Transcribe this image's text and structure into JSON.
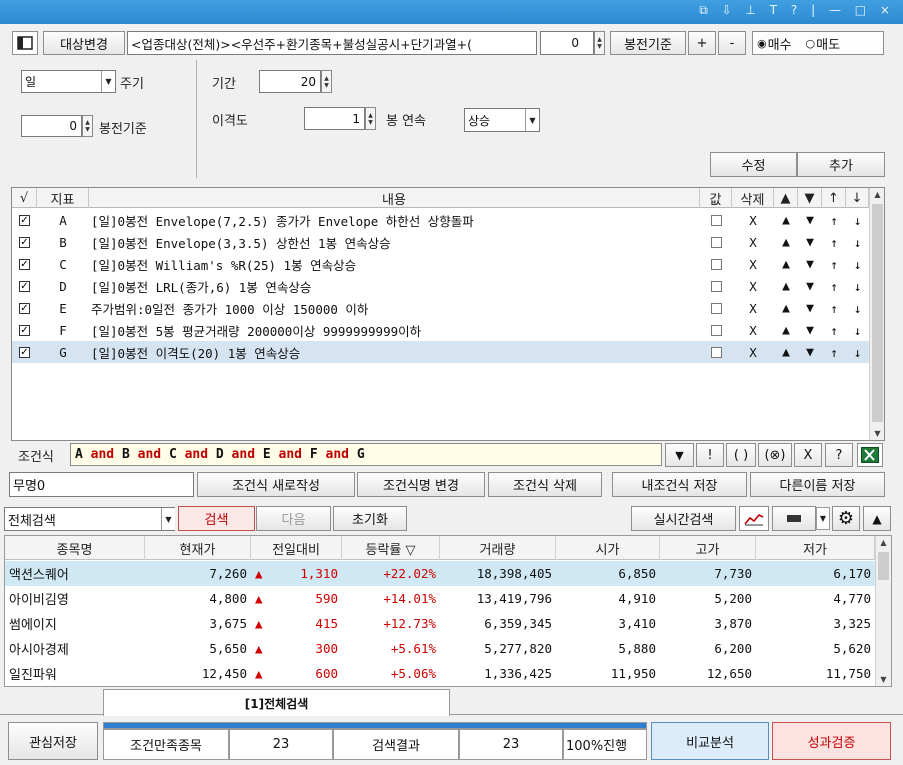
{
  "toolbar": {
    "target_change_label": "대상변경",
    "target_value": "<업종대상(전체)><우선주+환기종목+불성실공시+단기과열+(",
    "bong_value": "0",
    "bong_label": "봉전기준",
    "plus_label": "+",
    "minus_label": "-",
    "buy_label": "매수",
    "sell_label": "매도"
  },
  "params": {
    "period_type": "일",
    "cycle_label": "주기",
    "bong_value": "0",
    "bong_label": "봉전기준",
    "range_label": "기간",
    "range_value": "20",
    "disparity_label": "이격도",
    "consec_value": "1",
    "consec_label": "봉 연속",
    "direction": "상승",
    "edit_label": "수정",
    "add_label": "추가"
  },
  "conditions": {
    "headers": [
      "√",
      "지표",
      "내용",
      "값",
      "삭제",
      "▲",
      "▼",
      "↑",
      "↓"
    ],
    "rows": [
      {
        "id": "A",
        "content": "[일]0봉전 Envelope(7,2.5) 종가가 Envelope 하한선 상향돌파",
        "del": "X"
      },
      {
        "id": "B",
        "content": "[일]0봉전 Envelope(3,3.5) 상한선 1봉 연속상승",
        "del": "X"
      },
      {
        "id": "C",
        "content": "[일]0봉전 William's %R(25) 1봉 연속상승",
        "del": "X"
      },
      {
        "id": "D",
        "content": "[일]0봉전 LRL(종가,6) 1봉 연속상승",
        "del": "X"
      },
      {
        "id": "E",
        "content": "주가범위:0일전 종가가 1000 이상 150000 이하",
        "del": "X"
      },
      {
        "id": "F",
        "content": "[일]0봉전 5봉 평균거래량 200000이상 9999999999이하",
        "del": "X"
      },
      {
        "id": "G",
        "content": "[일]0봉전 이격도(20) 1봉 연속상승",
        "del": "X"
      }
    ]
  },
  "formula": {
    "label": "조건식",
    "tokens": [
      "A",
      " and ",
      "B",
      " and ",
      "C",
      " and ",
      "D",
      " and ",
      "E",
      " and ",
      "F",
      " and ",
      "G"
    ],
    "btn_down": "▼",
    "btn_not": "!",
    "btn_paren": "( )",
    "btn_xor": "(⊗)",
    "btn_x": "X",
    "btn_help": "?"
  },
  "actions": {
    "name_value": "무명0",
    "new_label": "조건식 새로작성",
    "rename_label": "조건식명 변경",
    "delete_label": "조건식 삭제",
    "save_label": "내조건식 저장",
    "save_as_label": "다른이름 저장"
  },
  "search": {
    "scope": "전체검색",
    "search_label": "검색",
    "next_label": "다음",
    "reset_label": "초기화",
    "realtime_label": "실시간검색"
  },
  "results": {
    "headers": [
      "종목명",
      "현재가",
      "전일대비",
      "등락률 ▽",
      "거래량",
      "시가",
      "고가",
      "저가"
    ],
    "rows": [
      {
        "name": "액션스퀘어",
        "price": "7,260",
        "change": "1,310",
        "rate": "+22.02%",
        "volume": "18,398,405",
        "open": "6,850",
        "high": "7,730",
        "low": "6,170"
      },
      {
        "name": "아이비김영",
        "price": "4,800",
        "change": "590",
        "rate": "+14.01%",
        "volume": "13,419,796",
        "open": "4,910",
        "high": "5,200",
        "low": "4,770"
      },
      {
        "name": "썸에이지",
        "price": "3,675",
        "change": "415",
        "rate": "+12.73%",
        "volume": "6,359,345",
        "open": "3,410",
        "high": "3,870",
        "low": "3,325"
      },
      {
        "name": "아시아경제",
        "price": "5,650",
        "change": "300",
        "rate": "+5.61%",
        "volume": "5,277,820",
        "open": "5,880",
        "high": "6,200",
        "low": "5,620"
      },
      {
        "name": "일진파워",
        "price": "12,450",
        "change": "600",
        "rate": "+5.06%",
        "volume": "1,336,425",
        "open": "11,950",
        "high": "12,650",
        "low": "11,750"
      }
    ]
  },
  "tab_label": "[1]전체검색",
  "status": {
    "watch_save_label": "관심저장",
    "match_label": "조건만족종목",
    "match_count": "23",
    "result_label": "검색결과",
    "result_count": "23",
    "progress_text": "100%진행",
    "progress": 1.0,
    "compare_label": "비교분석",
    "verify_label": "성과검증"
  }
}
